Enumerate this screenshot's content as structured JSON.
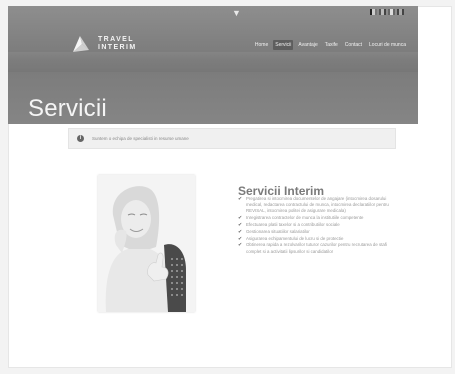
{
  "header": {
    "logo_line1": "TRAVEL",
    "logo_line2": "INTERIM",
    "nav": [
      {
        "label": "Home"
      },
      {
        "label": "Servicii"
      },
      {
        "label": "Avantaje"
      },
      {
        "label": "Taxife"
      },
      {
        "label": "Contact"
      },
      {
        "label": "Locuri de munca"
      }
    ],
    "active_nav": "Servicii",
    "flags": [
      {
        "name": "flag-1",
        "colors": [
          "#222222",
          "#cccccc",
          "#777777"
        ]
      },
      {
        "name": "flag-2",
        "colors": [
          "#555555",
          "#bbbbbb",
          "#444444"
        ]
      },
      {
        "name": "flag-3",
        "colors": [
          "#666666",
          "#dddddd",
          "#666666"
        ]
      },
      {
        "name": "flag-4",
        "colors": [
          "#444444",
          "#aaaaaa",
          "#444444"
        ]
      }
    ]
  },
  "page": {
    "title": "Servicii"
  },
  "notice": {
    "text": "Suntem o echipa de specialisti in resurse umane"
  },
  "services": {
    "title": "Servicii Interim",
    "items": [
      "Pregatirea si intocmirea documentelor de angajare (intocmirea dosarului medical, redactarea contractului de munca, intocmirea declaratiilor pentru REVISAL, intocmirea politei de asigurare medicala)",
      "Inregistrarea contractelor de munca la institutiile competente",
      "Efectuarea platii taxelor si a contributiilor sociale",
      "Gestionarea situatiilor salariatilor",
      "Asigurarea echipamentului de lucru si de protectie",
      "Obtinerea rapida a rezolvarilor tuturor cazurilor pentru recrutarea de stafi complet si a activitatii lipsurilor si candidatilor"
    ]
  }
}
